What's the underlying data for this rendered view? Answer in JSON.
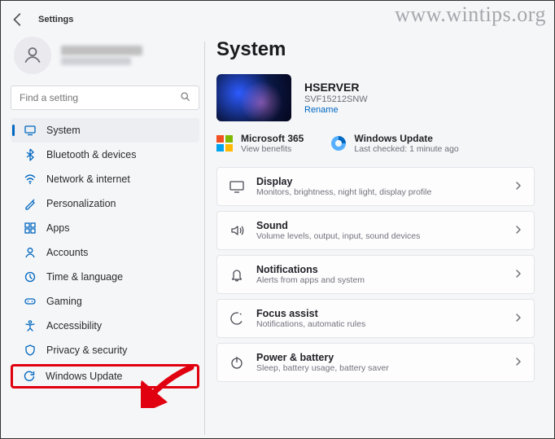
{
  "header": {
    "title": "Settings"
  },
  "profile": {
    "name_obscured": true,
    "email_obscured": true
  },
  "search": {
    "placeholder": "Find a setting"
  },
  "sidebar": {
    "items": [
      {
        "label": "System",
        "selected": true,
        "icon": "system"
      },
      {
        "label": "Bluetooth & devices",
        "icon": "bluetooth"
      },
      {
        "label": "Network & internet",
        "icon": "network"
      },
      {
        "label": "Personalization",
        "icon": "personalization"
      },
      {
        "label": "Apps",
        "icon": "apps"
      },
      {
        "label": "Accounts",
        "icon": "accounts"
      },
      {
        "label": "Time & language",
        "icon": "time"
      },
      {
        "label": "Gaming",
        "icon": "gaming"
      },
      {
        "label": "Accessibility",
        "icon": "accessibility"
      },
      {
        "label": "Privacy & security",
        "icon": "privacy"
      },
      {
        "label": "Windows Update",
        "icon": "update",
        "highlighted": true
      }
    ]
  },
  "main": {
    "title": "System",
    "device": {
      "name": "HSERVER",
      "model": "SVF15212SNW",
      "rename": "Rename"
    },
    "status": {
      "ms365": {
        "title": "Microsoft 365",
        "sub": "View benefits"
      },
      "wu": {
        "title": "Windows Update",
        "sub": "Last checked: 1 minute ago"
      }
    },
    "cards": [
      {
        "title": "Display",
        "sub": "Monitors, brightness, night light, display profile",
        "icon": "display"
      },
      {
        "title": "Sound",
        "sub": "Volume levels, output, input, sound devices",
        "icon": "sound"
      },
      {
        "title": "Notifications",
        "sub": "Alerts from apps and system",
        "icon": "notifications"
      },
      {
        "title": "Focus assist",
        "sub": "Notifications, automatic rules",
        "icon": "focus"
      },
      {
        "title": "Power & battery",
        "sub": "Sleep, battery usage, battery saver",
        "icon": "power"
      }
    ]
  },
  "watermark": "www.wintips.org"
}
